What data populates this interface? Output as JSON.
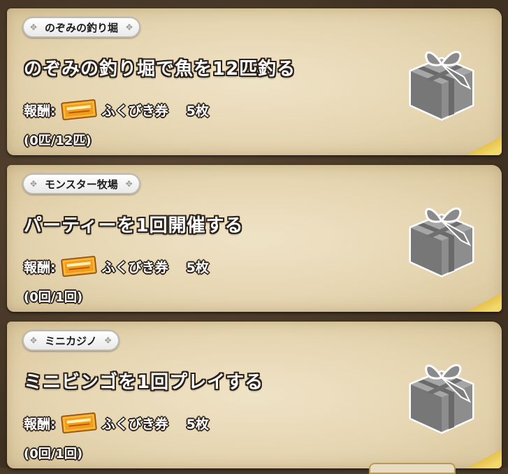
{
  "missions": [
    {
      "category": "のぞみの釣り堀",
      "title": "のぞみの釣り堀で魚を12匹釣る",
      "reward_label": "報酬:",
      "reward_item": "ふくびき券",
      "reward_count": "5枚",
      "progress": "(0匹/12匹)"
    },
    {
      "category": "モンスター牧場",
      "title": "パーティーを1回開催する",
      "reward_label": "報酬:",
      "reward_item": "ふくびき券",
      "reward_count": "5枚",
      "progress": "(0回/1回)"
    },
    {
      "category": "ミニカジノ",
      "title": "ミニビンゴを1回プレイする",
      "reward_label": "報酬:",
      "reward_item": "ふくびき券",
      "reward_count": "5枚",
      "progress": "(0回/1回)"
    }
  ],
  "icons": {
    "reward": "ticket-icon",
    "status": "gift-box-icon"
  },
  "colors": {
    "card_background": "#e6d6b2",
    "text_outline": "#2b2118",
    "ticket": "#f39b1a",
    "gift_box": "#8d8d8d"
  }
}
